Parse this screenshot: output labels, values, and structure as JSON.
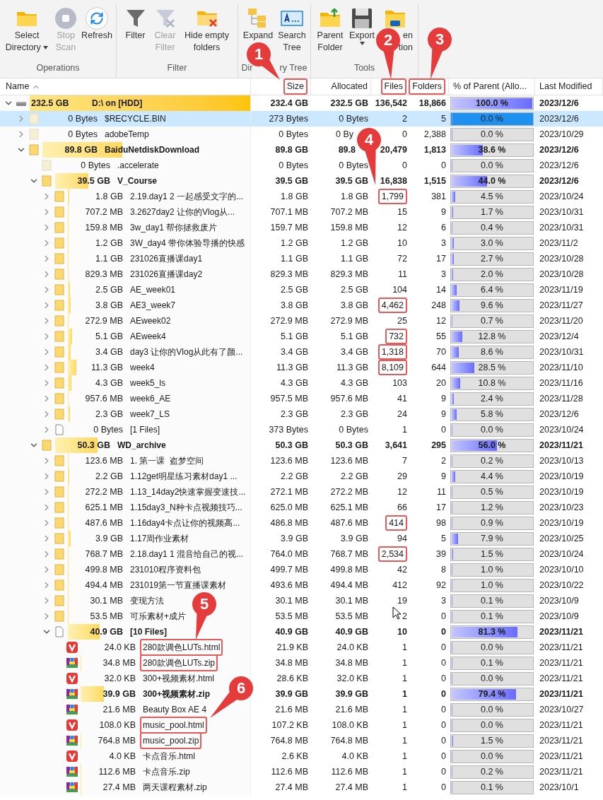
{
  "toolbar": {
    "groups": [
      {
        "label_parts": [
          "Operations"
        ],
        "buttons": [
          {
            "lines": [
              "Select",
              "Directory"
            ],
            "dropdown": true,
            "disabled": false
          },
          {
            "lines": [
              "Stop",
              "Scan"
            ],
            "dropdown": false,
            "disabled": true
          },
          {
            "lines": [
              "Refresh"
            ],
            "dropdown": false,
            "disabled": false
          }
        ]
      },
      {
        "label_parts": [
          "Filter"
        ],
        "buttons": [
          {
            "lines": [
              "Filter"
            ],
            "dropdown": false,
            "disabled": false
          },
          {
            "lines": [
              "Clear",
              "Filter"
            ],
            "dropdown": false,
            "disabled": true
          },
          {
            "lines": [
              "Hide empty",
              "folders"
            ],
            "dropdown": false,
            "disabled": false
          }
        ]
      },
      {
        "label_parts": [
          "Dir",
          "ry Tree"
        ],
        "buttons": [
          {
            "lines": [
              "Expand"
            ],
            "dropdown": false,
            "disabled": false
          },
          {
            "lines": [
              "Search",
              "Tree"
            ],
            "dropdown": false,
            "disabled": false
          }
        ]
      },
      {
        "label_parts": [
          "Tools"
        ],
        "buttons": [
          {
            "lines": [
              "Parent",
              "Folder"
            ],
            "dropdown": false,
            "disabled": false
          },
          {
            "lines": [
              "Export"
            ],
            "dropdown": true,
            "disabled": false
          },
          {
            "lines": [
              "en",
              "tion"
            ],
            "dropdown": false,
            "disabled": false
          }
        ]
      }
    ]
  },
  "columns": [
    {
      "label": "Name",
      "sorted": true,
      "highlighted": false
    },
    {
      "label": "Size",
      "sorted": false,
      "highlighted": true
    },
    {
      "label": "Allocated",
      "sorted": false,
      "highlighted": false
    },
    {
      "label": "Files",
      "sorted": false,
      "highlighted": true
    },
    {
      "label": "Folders",
      "sorted": false,
      "highlighted": true
    },
    {
      "label": "% of Parent (Allo...",
      "sorted": false,
      "highlighted": false
    },
    {
      "label": "Last Modified",
      "sorted": false,
      "highlighted": false
    }
  ],
  "rows": [
    {
      "kind": "drive",
      "expanded": true,
      "bold": true,
      "selected": false,
      "highlighted": false,
      "size_label": "232.5 GB",
      "name": "D:\\ on [HDD]",
      "size": "232.4 GB",
      "allocated": "232.5 GB",
      "files": "136,542",
      "folders": "18,866",
      "percent": "100.0 %",
      "level": 1,
      "modified": "2023/12/6",
      "children": [
        {
          "kind": "hidden_folder",
          "expanded": false,
          "bold": false,
          "selected": true,
          "highlighted": false,
          "size_label": "0 Bytes",
          "name": "$RECYCLE.BIN",
          "size": "273 Bytes",
          "allocated": "0 Bytes",
          "files": "2",
          "folders": "5",
          "percent": "0.0 %",
          "level": 0,
          "modified": "2023/12/6"
        },
        {
          "kind": "hidden_folder",
          "expanded": false,
          "bold": false,
          "selected": false,
          "highlighted": false,
          "size_label": "0 Bytes",
          "name": "adobeTemp",
          "size": "0 Bytes",
          "allocated": "0 By",
          "files": "0",
          "folders": "2,388",
          "percent": "0.0 %",
          "level": 0,
          "modified": "2023/10/29"
        },
        {
          "kind": "folder",
          "expanded": true,
          "bold": true,
          "selected": false,
          "highlighted": false,
          "size_label": "89.8 GB",
          "name": "BaiduNetdiskDownload",
          "size": "89.8 GB",
          "allocated": "89.8",
          "files": "20,479",
          "folders": "1,813",
          "percent": "38.6 %",
          "level": 0.386,
          "modified": "2023/12/6",
          "children": [
            {
              "kind": "hidden_folder",
              "bold": false,
              "selected": false,
              "highlighted": false,
              "size_label": "0 Bytes",
              "name": ".accelerate",
              "size": "0 Bytes",
              "allocated": "0 Bytes",
              "files": "0",
              "folders": "0",
              "percent": "0.0 %",
              "level": 0,
              "modified": "2023/12/6"
            },
            {
              "kind": "folder",
              "expanded": true,
              "bold": true,
              "selected": false,
              "highlighted": false,
              "size_label": "39.5 GB",
              "name": "V_Course",
              "size": "39.5 GB",
              "allocated": "39.5 GB",
              "files": "16,838",
              "folders": "1,515",
              "percent": "44.0 %",
              "level": 0.44,
              "modified": "2023/12/6",
              "children": [
                {
                  "kind": "folder",
                  "expanded": false,
                  "bold": false,
                  "selected": false,
                  "highlighted": true,
                  "size_label": "1.8 GB",
                  "name": "2.19.day1 2 一起感受文字的...",
                  "size": "1.8 GB",
                  "allocated": "1.8 GB",
                  "files": "1,799",
                  "folders": "381",
                  "percent": "4.5 %",
                  "level": 0.045,
                  "modified": "2023/10/24"
                },
                {
                  "kind": "folder",
                  "expanded": false,
                  "bold": false,
                  "selected": false,
                  "highlighted": false,
                  "size_label": "707.2 MB",
                  "name": "3.2627day2 让你的Vlog从...",
                  "size": "707.1 MB",
                  "allocated": "707.2 MB",
                  "files": "15",
                  "folders": "9",
                  "percent": "1.7 %",
                  "level": 0.017,
                  "modified": "2023/10/31"
                },
                {
                  "kind": "folder",
                  "expanded": false,
                  "bold": false,
                  "selected": false,
                  "highlighted": false,
                  "size_label": "159.8 MB",
                  "name": "3w_day1 帮你拯救废片",
                  "size": "159.7 MB",
                  "allocated": "159.8 MB",
                  "files": "12",
                  "folders": "6",
                  "percent": "0.4 %",
                  "level": 0.004,
                  "modified": "2023/10/31"
                },
                {
                  "kind": "folder",
                  "expanded": false,
                  "bold": false,
                  "selected": false,
                  "highlighted": false,
                  "size_label": "1.2 GB",
                  "name": "3W_day4 带你体验导播的快感",
                  "size": "1.2 GB",
                  "allocated": "1.2 GB",
                  "files": "10",
                  "folders": "3",
                  "percent": "3.0 %",
                  "level": 0.03,
                  "modified": "2023/11/2"
                },
                {
                  "kind": "folder",
                  "expanded": false,
                  "bold": false,
                  "selected": false,
                  "highlighted": false,
                  "size_label": "1.1 GB",
                  "name": "231026直播课day1",
                  "size": "1.1 GB",
                  "allocated": "1.1 GB",
                  "files": "72",
                  "folders": "17",
                  "percent": "2.7 %",
                  "level": 0.027,
                  "modified": "2023/10/28"
                },
                {
                  "kind": "folder",
                  "expanded": false,
                  "bold": false,
                  "selected": false,
                  "highlighted": false,
                  "size_label": "829.3 MB",
                  "name": "231026直播课day2",
                  "size": "829.3 MB",
                  "allocated": "829.3 MB",
                  "files": "11",
                  "folders": "3",
                  "percent": "2.0 %",
                  "level": 0.02,
                  "modified": "2023/10/28"
                },
                {
                  "kind": "folder",
                  "expanded": false,
                  "bold": false,
                  "selected": false,
                  "highlighted": false,
                  "size_label": "2.5 GB",
                  "name": "AE_week01",
                  "size": "2.5 GB",
                  "allocated": "2.5 GB",
                  "files": "104",
                  "folders": "14",
                  "percent": "6.4 %",
                  "level": 0.064,
                  "modified": "2023/11/19"
                },
                {
                  "kind": "folder",
                  "expanded": false,
                  "bold": false,
                  "selected": false,
                  "highlighted": true,
                  "size_label": "3.8 GB",
                  "name": "AE3_week7",
                  "size": "3.8 GB",
                  "allocated": "3.8 GB",
                  "files": "4,462",
                  "folders": "248",
                  "percent": "9.6 %",
                  "level": 0.096,
                  "modified": "2023/11/27"
                },
                {
                  "kind": "folder",
                  "expanded": false,
                  "bold": false,
                  "selected": false,
                  "highlighted": false,
                  "size_label": "272.9 MB",
                  "name": "AEweek02",
                  "size": "272.9 MB",
                  "allocated": "272.9 MB",
                  "files": "25",
                  "folders": "12",
                  "percent": "0.7 %",
                  "level": 0.007,
                  "modified": "2023/11/20"
                },
                {
                  "kind": "folder",
                  "expanded": false,
                  "bold": false,
                  "selected": false,
                  "highlighted": true,
                  "size_label": "5.1 GB",
                  "name": "AEweek4",
                  "size": "5.1 GB",
                  "allocated": "5.1 GB",
                  "files": "732",
                  "folders": "55",
                  "percent": "12.8 %",
                  "level": 0.128,
                  "modified": "2023/12/4"
                },
                {
                  "kind": "folder",
                  "expanded": false,
                  "bold": false,
                  "selected": false,
                  "highlighted": true,
                  "size_label": "3.4 GB",
                  "name": "day3 让你的Vlog从此有了颜...",
                  "size": "3.4 GB",
                  "allocated": "3.4 GB",
                  "files": "1,318",
                  "folders": "70",
                  "percent": "8.6 %",
                  "level": 0.086,
                  "modified": "2023/10/31"
                },
                {
                  "kind": "folder",
                  "expanded": false,
                  "bold": false,
                  "selected": false,
                  "highlighted": true,
                  "size_label": "11.3 GB",
                  "name": "week4",
                  "size": "11.3 GB",
                  "allocated": "11.3 GB",
                  "files": "8,109",
                  "folders": "644",
                  "percent": "28.5 %",
                  "level": 0.285,
                  "modified": "2023/11/10"
                },
                {
                  "kind": "folder",
                  "expanded": false,
                  "bold": false,
                  "selected": false,
                  "highlighted": false,
                  "size_label": "4.3 GB",
                  "name": "week5_ls",
                  "size": "4.3 GB",
                  "allocated": "4.3 GB",
                  "files": "103",
                  "folders": "20",
                  "percent": "10.8 %",
                  "level": 0.108,
                  "modified": "2023/11/16"
                },
                {
                  "kind": "folder",
                  "expanded": false,
                  "bold": false,
                  "selected": false,
                  "highlighted": false,
                  "size_label": "957.6 MB",
                  "name": "week6_AE",
                  "size": "957.5 MB",
                  "allocated": "957.6 MB",
                  "files": "41",
                  "folders": "9",
                  "percent": "2.4 %",
                  "level": 0.024,
                  "modified": "2023/11/28"
                },
                {
                  "kind": "folder",
                  "expanded": false,
                  "bold": false,
                  "selected": false,
                  "highlighted": false,
                  "size_label": "2.3 GB",
                  "name": "week7_LS",
                  "size": "2.3 GB",
                  "allocated": "2.3 GB",
                  "files": "24",
                  "folders": "9",
                  "percent": "5.8 %",
                  "level": 0.058,
                  "modified": "2023/12/6"
                },
                {
                  "kind": "files",
                  "expanded": false,
                  "bold": false,
                  "selected": false,
                  "highlighted": false,
                  "size_label": "0 Bytes",
                  "name": "[1 Files]",
                  "size": "373 Bytes",
                  "allocated": "0 Bytes",
                  "files": "1",
                  "folders": "0",
                  "percent": "0.0 %",
                  "level": 0,
                  "modified": "2023/10/24"
                }
              ]
            },
            {
              "kind": "folder",
              "expanded": true,
              "bold": true,
              "selected": false,
              "highlighted": false,
              "size_label": "50.3 GB",
              "name": "WD_archive",
              "size": "50.3 GB",
              "allocated": "50.3 GB",
              "files": "3,641",
              "folders": "295",
              "percent": "56.0 %",
              "level": 0.56,
              "modified": "2023/11/21",
              "children": [
                {
                  "kind": "folder",
                  "expanded": false,
                  "bold": false,
                  "selected": false,
                  "highlighted": false,
                  "size_label": "123.6 MB",
                  "name": "1. 第一课  盗梦空间",
                  "size": "123.6 MB",
                  "allocated": "123.6 MB",
                  "files": "7",
                  "folders": "2",
                  "percent": "0.2 %",
                  "level": 0.002,
                  "modified": "2023/10/13"
                },
                {
                  "kind": "folder",
                  "expanded": false,
                  "bold": false,
                  "selected": false,
                  "highlighted": false,
                  "size_label": "2.2 GB",
                  "name": "1.12get明星练习素材day1 ...",
                  "size": "2.2 GB",
                  "allocated": "2.2 GB",
                  "files": "29",
                  "folders": "9",
                  "percent": "4.4 %",
                  "level": 0.044,
                  "modified": "2023/10/19"
                },
                {
                  "kind": "folder",
                  "expanded": false,
                  "bold": false,
                  "selected": false,
                  "highlighted": false,
                  "size_label": "272.2 MB",
                  "name": "1.13_14day2快速掌握变速技...",
                  "size": "272.1 MB",
                  "allocated": "272.2 MB",
                  "files": "12",
                  "folders": "11",
                  "percent": "0.5 %",
                  "level": 0.005,
                  "modified": "2023/10/19"
                },
                {
                  "kind": "folder",
                  "expanded": false,
                  "bold": false,
                  "selected": false,
                  "highlighted": false,
                  "size_label": "625.1 MB",
                  "name": "1.15day3_N种卡点视频技巧...",
                  "size": "625.0 MB",
                  "allocated": "625.1 MB",
                  "files": "66",
                  "folders": "17",
                  "percent": "1.2 %",
                  "level": 0.012,
                  "modified": "2023/10/23"
                },
                {
                  "kind": "folder",
                  "expanded": false,
                  "bold": false,
                  "selected": false,
                  "highlighted": true,
                  "size_label": "487.6 MB",
                  "name": "1.16day4卡点让你的视频高...",
                  "size": "486.8 MB",
                  "allocated": "487.6 MB",
                  "files": "414",
                  "folders": "98",
                  "percent": "0.9 %",
                  "level": 0.009,
                  "modified": "2023/10/19"
                },
                {
                  "kind": "folder",
                  "expanded": false,
                  "bold": false,
                  "selected": false,
                  "highlighted": false,
                  "size_label": "3.9 GB",
                  "name": "1.17周作业素材",
                  "size": "3.9 GB",
                  "allocated": "3.9 GB",
                  "files": "94",
                  "folders": "5",
                  "percent": "7.9 %",
                  "level": 0.079,
                  "modified": "2023/10/25"
                },
                {
                  "kind": "folder",
                  "expanded": false,
                  "bold": false,
                  "selected": false,
                  "highlighted": true,
                  "size_label": "768.7 MB",
                  "name": "2.18.day1 1 混音给自己的视...",
                  "size": "764.0 MB",
                  "allocated": "768.7 MB",
                  "files": "2,534",
                  "folders": "39",
                  "percent": "1.5 %",
                  "level": 0.015,
                  "modified": "2023/10/24"
                },
                {
                  "kind": "folder",
                  "expanded": false,
                  "bold": false,
                  "selected": false,
                  "highlighted": false,
                  "size_label": "499.8 MB",
                  "name": "231010程序资料包",
                  "size": "499.7 MB",
                  "allocated": "499.8 MB",
                  "files": "42",
                  "folders": "8",
                  "percent": "1.0 %",
                  "level": 0.01,
                  "modified": "2023/10/10"
                },
                {
                  "kind": "folder",
                  "expanded": false,
                  "bold": false,
                  "selected": false,
                  "highlighted": false,
                  "size_label": "494.4 MB",
                  "name": "231019第一节直播课素材",
                  "size": "493.6 MB",
                  "allocated": "494.4 MB",
                  "files": "412",
                  "folders": "92",
                  "percent": "1.0 %",
                  "level": 0.01,
                  "modified": "2023/10/22"
                },
                {
                  "kind": "folder",
                  "expanded": false,
                  "bold": false,
                  "selected": false,
                  "highlighted": false,
                  "size_label": "30.1 MB",
                  "name": "变现方法",
                  "size": "30.1 MB",
                  "allocated": "30.1 MB",
                  "files": "19",
                  "folders": "3",
                  "percent": "0.1 %",
                  "level": 0.001,
                  "modified": "2023/10/9"
                },
                {
                  "kind": "folder",
                  "expanded": false,
                  "bold": false,
                  "selected": false,
                  "highlighted": false,
                  "size_label": "53.5 MB",
                  "name": "可乐素材+成片",
                  "size": "53.5 MB",
                  "allocated": "53.5 MB",
                  "files": "2",
                  "folders": "0",
                  "percent": "0.1 %",
                  "level": 0.001,
                  "modified": "2023/10/9"
                },
                {
                  "kind": "files",
                  "expanded": true,
                  "bold": true,
                  "selected": false,
                  "highlighted": false,
                  "size_label": "40.9 GB",
                  "name": "[10 Files]",
                  "size": "40.9 GB",
                  "allocated": "40.9 GB",
                  "files": "10",
                  "folders": "0",
                  "percent": "81.3 %",
                  "level": 0.813,
                  "modified": "2023/11/21",
                  "children": [
                    {
                      "kind": "html",
                      "bold": false,
                      "selected": false,
                      "highlighted": true,
                      "size_label": "24.0 KB",
                      "name": "280款调色LUTs.html",
                      "size": "21.9 KB",
                      "allocated": "24.0 KB",
                      "files": "1",
                      "folders": "0",
                      "percent": "0.0 %",
                      "level": 0,
                      "modified": "2023/11/21"
                    },
                    {
                      "kind": "zip",
                      "bold": false,
                      "selected": false,
                      "highlighted": true,
                      "size_label": "34.8 MB",
                      "name": "280款调色LUTs.zip",
                      "size": "34.8 MB",
                      "allocated": "34.8 MB",
                      "files": "1",
                      "folders": "0",
                      "percent": "0.1 %",
                      "level": 0.001,
                      "modified": "2023/11/21"
                    },
                    {
                      "kind": "html",
                      "bold": false,
                      "selected": false,
                      "highlighted": false,
                      "size_label": "32.0 KB",
                      "name": "300+视频素材.html",
                      "size": "28.6 KB",
                      "allocated": "32.0 KB",
                      "files": "1",
                      "folders": "0",
                      "percent": "0.0 %",
                      "level": 0,
                      "modified": "2023/11/21"
                    },
                    {
                      "kind": "zip",
                      "bold": true,
                      "selected": false,
                      "highlighted": false,
                      "size_label": "39.9 GB",
                      "name": "300+视频素材.zip",
                      "size": "39.9 GB",
                      "allocated": "39.9 GB",
                      "files": "1",
                      "folders": "0",
                      "percent": "79.4 %",
                      "level": 0.794,
                      "modified": "2023/11/21"
                    },
                    {
                      "kind": "zip",
                      "bold": false,
                      "selected": false,
                      "highlighted": false,
                      "size_label": "21.6 MB",
                      "name": "Beauty Box AE 4",
                      "size": "21.6 MB",
                      "allocated": "21.6 MB",
                      "files": "1",
                      "folders": "0",
                      "percent": "0.0 %",
                      "level": 0,
                      "modified": "2023/10/27"
                    },
                    {
                      "kind": "html",
                      "bold": false,
                      "selected": false,
                      "highlighted": true,
                      "size_label": "108.0 KB",
                      "name": "music_pool.html",
                      "size": "107.2 KB",
                      "allocated": "108.0 KB",
                      "files": "1",
                      "folders": "0",
                      "percent": "0.0 %",
                      "level": 0,
                      "modified": "2023/11/21"
                    },
                    {
                      "kind": "zip",
                      "bold": false,
                      "selected": false,
                      "highlighted": true,
                      "size_label": "764.8 MB",
                      "name": "music_pool.zip",
                      "size": "764.8 MB",
                      "allocated": "764.8 MB",
                      "files": "1",
                      "folders": "0",
                      "percent": "1.5 %",
                      "level": 0.015,
                      "modified": "2023/11/21"
                    },
                    {
                      "kind": "html",
                      "bold": false,
                      "selected": false,
                      "highlighted": false,
                      "size_label": "4.0 KB",
                      "name": "卡点音乐.html",
                      "size": "2.6 KB",
                      "allocated": "4.0 KB",
                      "files": "1",
                      "folders": "0",
                      "percent": "0.0 %",
                      "level": 0,
                      "modified": "2023/11/21"
                    },
                    {
                      "kind": "zip",
                      "bold": false,
                      "selected": false,
                      "highlighted": false,
                      "size_label": "112.6 MB",
                      "name": "卡点音乐.zip",
                      "size": "112.6 MB",
                      "allocated": "112.6 MB",
                      "files": "1",
                      "folders": "0",
                      "percent": "0.2 %",
                      "level": 0.002,
                      "modified": "2023/11/21"
                    },
                    {
                      "kind": "zip",
                      "bold": false,
                      "selected": false,
                      "highlighted": false,
                      "size_label": "27.4 MB",
                      "name": "两天课程素材.zip",
                      "size": "27.4 MB",
                      "allocated": "27.4 MB",
                      "files": "1",
                      "folders": "0",
                      "percent": "0.1 %",
                      "level": 0.001,
                      "modified": "2023/10/1"
                    }
                  ]
                }
              ]
            }
          ]
        }
      ]
    }
  ],
  "callouts": [
    {
      "label": "1"
    },
    {
      "label": "2"
    },
    {
      "label": "3"
    },
    {
      "label": "4"
    },
    {
      "label": "5"
    },
    {
      "label": "6"
    }
  ]
}
